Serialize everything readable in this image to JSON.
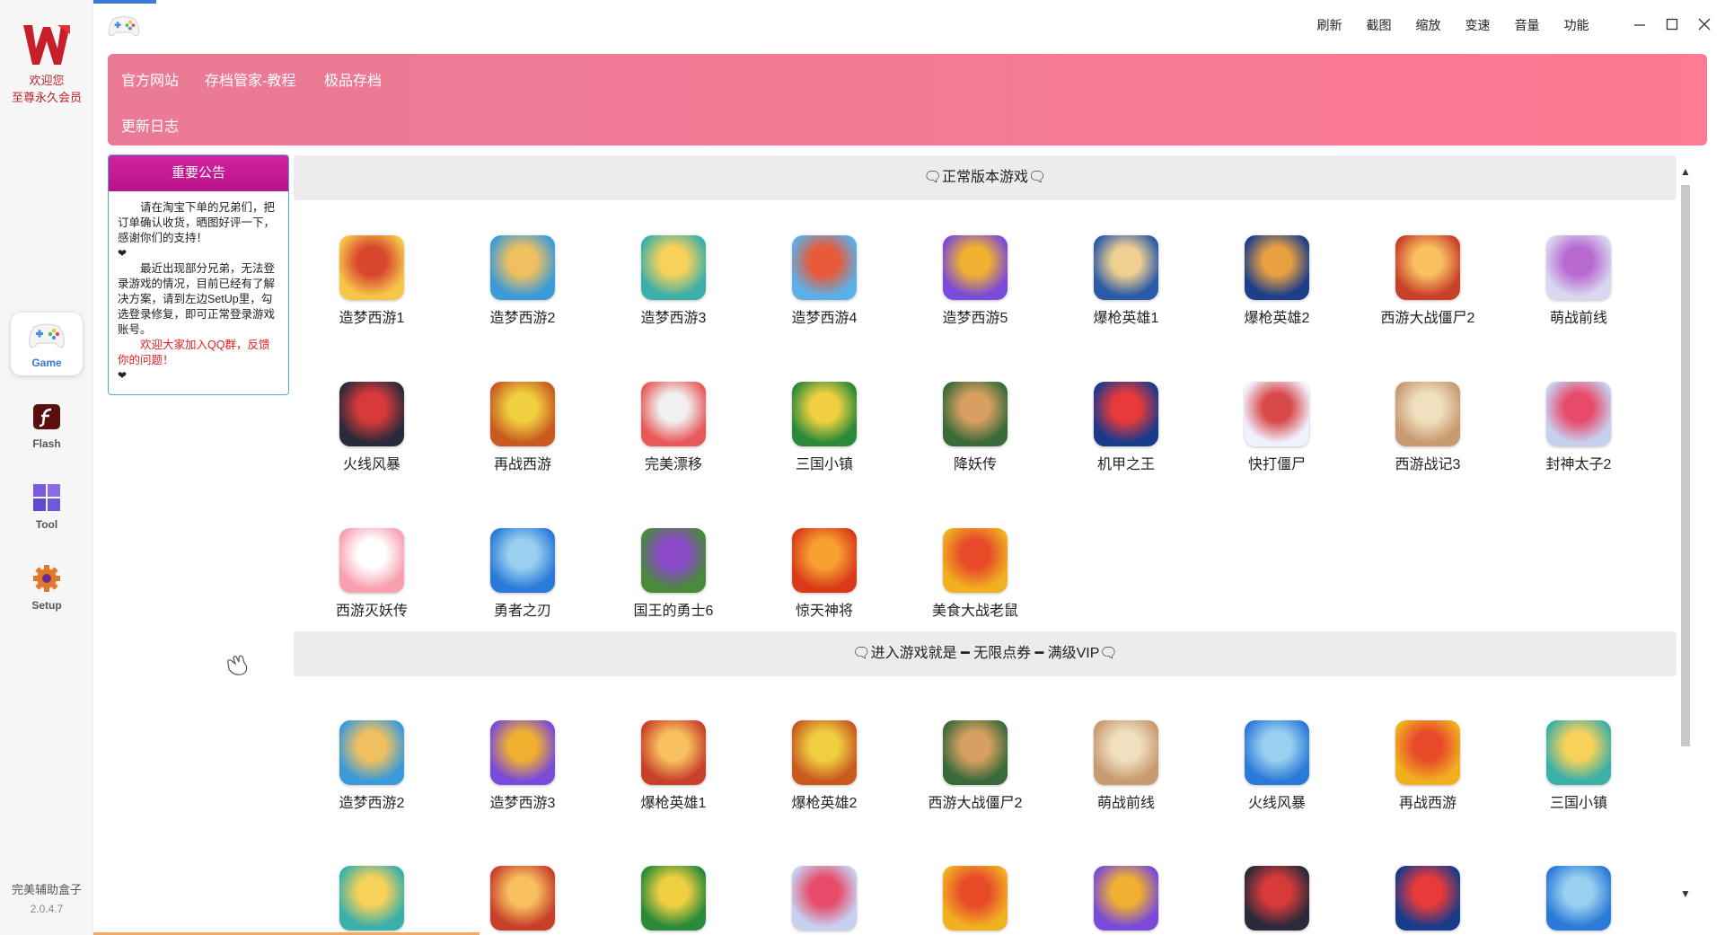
{
  "sidebar": {
    "welcome_line1": "欢迎您",
    "welcome_line2": "至尊永久会员",
    "nav": [
      {
        "label": "Game",
        "icon": "gamepad-icon",
        "active": true
      },
      {
        "label": "Flash",
        "icon": "flash-icon"
      },
      {
        "label": "Tool",
        "icon": "grid-tool-icon"
      },
      {
        "label": "Setup",
        "icon": "gear-icon"
      }
    ],
    "brand": "完美辅助盒子",
    "version": "2.0.4.7"
  },
  "toolbar": {
    "items": [
      "刷新",
      "截图",
      "缩放",
      "变速",
      "音量",
      "功能"
    ]
  },
  "banner": {
    "links": [
      "官方网站",
      "存档管家-教程",
      "极品存档",
      "更新日志"
    ]
  },
  "notice": {
    "title": "重要公告",
    "p1": "请在淘宝下单的兄弟们，把订单确认收货，晒图好评一下，感谢你们的支持！",
    "p2": "最近出现部分兄弟，无法登录游戏的情况，目前已经有了解决方案，请到左边SetUp里，勾选登录修复，即可正常登录游戏账号。",
    "p3": "欢迎大家加入QQ群，反馈你的问题！",
    "heart": "❤"
  },
  "sections": [
    {
      "title": "正常版本游戏",
      "games": [
        "造梦西游1",
        "造梦西游2",
        "造梦西游3",
        "造梦西游4",
        "造梦西游5",
        "爆枪英雄1",
        "爆枪英雄2",
        "西游大战僵尸2",
        "萌战前线",
        "火线风暴",
        "再战西游",
        "完美漂移",
        "三国小镇",
        "降妖传",
        "机甲之王",
        "快打僵尸",
        "西游战记3",
        "封神太子2",
        "西游灭妖传",
        "勇者之刃",
        "国王的勇士6",
        "惊天神将",
        "美食大战老鼠"
      ]
    },
    {
      "title": "进入游戏就是 ━ 无限点券 ━ 满级VIP",
      "games": [
        "造梦西游2",
        "造梦西游3",
        "爆枪英雄1",
        "爆枪英雄2",
        "西游大战僵尸2",
        "萌战前线",
        "火线风暴",
        "再战西游",
        "三国小镇"
      ]
    }
  ],
  "colors": {
    "banner": "#f37a95",
    "notice_head": "#c41a93",
    "accent": "#3a79d6"
  }
}
